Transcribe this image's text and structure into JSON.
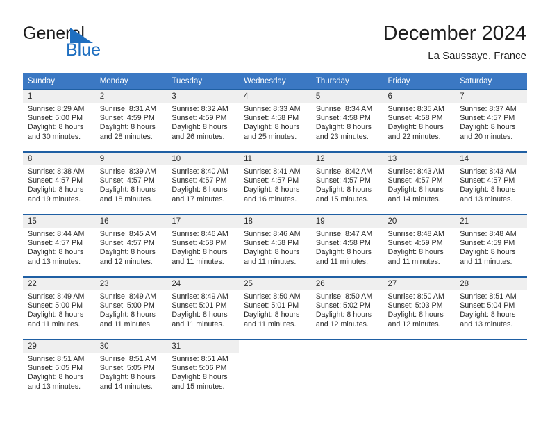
{
  "brand": {
    "name_part1": "General",
    "name_part2": "Blue",
    "triangle_color": "#1f6fc0",
    "icon": "triangle-flag-icon"
  },
  "header": {
    "title": "December 2024",
    "subtitle": "La Saussaye, France"
  },
  "theme": {
    "header_bg": "#3b78c3",
    "row_border": "#1f5fa3",
    "daynum_bg": "#efefef",
    "text": "#2b2b2b",
    "brand_blue": "#1f6fc0"
  },
  "weekdays": [
    "Sunday",
    "Monday",
    "Tuesday",
    "Wednesday",
    "Thursday",
    "Friday",
    "Saturday"
  ],
  "weeks": [
    [
      {
        "day": "1",
        "sunrise": "Sunrise: 8:29 AM",
        "sunset": "Sunset: 5:00 PM",
        "daylight1": "Daylight: 8 hours",
        "daylight2": "and 30 minutes."
      },
      {
        "day": "2",
        "sunrise": "Sunrise: 8:31 AM",
        "sunset": "Sunset: 4:59 PM",
        "daylight1": "Daylight: 8 hours",
        "daylight2": "and 28 minutes."
      },
      {
        "day": "3",
        "sunrise": "Sunrise: 8:32 AM",
        "sunset": "Sunset: 4:59 PM",
        "daylight1": "Daylight: 8 hours",
        "daylight2": "and 26 minutes."
      },
      {
        "day": "4",
        "sunrise": "Sunrise: 8:33 AM",
        "sunset": "Sunset: 4:58 PM",
        "daylight1": "Daylight: 8 hours",
        "daylight2": "and 25 minutes."
      },
      {
        "day": "5",
        "sunrise": "Sunrise: 8:34 AM",
        "sunset": "Sunset: 4:58 PM",
        "daylight1": "Daylight: 8 hours",
        "daylight2": "and 23 minutes."
      },
      {
        "day": "6",
        "sunrise": "Sunrise: 8:35 AM",
        "sunset": "Sunset: 4:58 PM",
        "daylight1": "Daylight: 8 hours",
        "daylight2": "and 22 minutes."
      },
      {
        "day": "7",
        "sunrise": "Sunrise: 8:37 AM",
        "sunset": "Sunset: 4:57 PM",
        "daylight1": "Daylight: 8 hours",
        "daylight2": "and 20 minutes."
      }
    ],
    [
      {
        "day": "8",
        "sunrise": "Sunrise: 8:38 AM",
        "sunset": "Sunset: 4:57 PM",
        "daylight1": "Daylight: 8 hours",
        "daylight2": "and 19 minutes."
      },
      {
        "day": "9",
        "sunrise": "Sunrise: 8:39 AM",
        "sunset": "Sunset: 4:57 PM",
        "daylight1": "Daylight: 8 hours",
        "daylight2": "and 18 minutes."
      },
      {
        "day": "10",
        "sunrise": "Sunrise: 8:40 AM",
        "sunset": "Sunset: 4:57 PM",
        "daylight1": "Daylight: 8 hours",
        "daylight2": "and 17 minutes."
      },
      {
        "day": "11",
        "sunrise": "Sunrise: 8:41 AM",
        "sunset": "Sunset: 4:57 PM",
        "daylight1": "Daylight: 8 hours",
        "daylight2": "and 16 minutes."
      },
      {
        "day": "12",
        "sunrise": "Sunrise: 8:42 AM",
        "sunset": "Sunset: 4:57 PM",
        "daylight1": "Daylight: 8 hours",
        "daylight2": "and 15 minutes."
      },
      {
        "day": "13",
        "sunrise": "Sunrise: 8:43 AM",
        "sunset": "Sunset: 4:57 PM",
        "daylight1": "Daylight: 8 hours",
        "daylight2": "and 14 minutes."
      },
      {
        "day": "14",
        "sunrise": "Sunrise: 8:43 AM",
        "sunset": "Sunset: 4:57 PM",
        "daylight1": "Daylight: 8 hours",
        "daylight2": "and 13 minutes."
      }
    ],
    [
      {
        "day": "15",
        "sunrise": "Sunrise: 8:44 AM",
        "sunset": "Sunset: 4:57 PM",
        "daylight1": "Daylight: 8 hours",
        "daylight2": "and 13 minutes."
      },
      {
        "day": "16",
        "sunrise": "Sunrise: 8:45 AM",
        "sunset": "Sunset: 4:57 PM",
        "daylight1": "Daylight: 8 hours",
        "daylight2": "and 12 minutes."
      },
      {
        "day": "17",
        "sunrise": "Sunrise: 8:46 AM",
        "sunset": "Sunset: 4:58 PM",
        "daylight1": "Daylight: 8 hours",
        "daylight2": "and 11 minutes."
      },
      {
        "day": "18",
        "sunrise": "Sunrise: 8:46 AM",
        "sunset": "Sunset: 4:58 PM",
        "daylight1": "Daylight: 8 hours",
        "daylight2": "and 11 minutes."
      },
      {
        "day": "19",
        "sunrise": "Sunrise: 8:47 AM",
        "sunset": "Sunset: 4:58 PM",
        "daylight1": "Daylight: 8 hours",
        "daylight2": "and 11 minutes."
      },
      {
        "day": "20",
        "sunrise": "Sunrise: 8:48 AM",
        "sunset": "Sunset: 4:59 PM",
        "daylight1": "Daylight: 8 hours",
        "daylight2": "and 11 minutes."
      },
      {
        "day": "21",
        "sunrise": "Sunrise: 8:48 AM",
        "sunset": "Sunset: 4:59 PM",
        "daylight1": "Daylight: 8 hours",
        "daylight2": "and 11 minutes."
      }
    ],
    [
      {
        "day": "22",
        "sunrise": "Sunrise: 8:49 AM",
        "sunset": "Sunset: 5:00 PM",
        "daylight1": "Daylight: 8 hours",
        "daylight2": "and 11 minutes."
      },
      {
        "day": "23",
        "sunrise": "Sunrise: 8:49 AM",
        "sunset": "Sunset: 5:00 PM",
        "daylight1": "Daylight: 8 hours",
        "daylight2": "and 11 minutes."
      },
      {
        "day": "24",
        "sunrise": "Sunrise: 8:49 AM",
        "sunset": "Sunset: 5:01 PM",
        "daylight1": "Daylight: 8 hours",
        "daylight2": "and 11 minutes."
      },
      {
        "day": "25",
        "sunrise": "Sunrise: 8:50 AM",
        "sunset": "Sunset: 5:01 PM",
        "daylight1": "Daylight: 8 hours",
        "daylight2": "and 11 minutes."
      },
      {
        "day": "26",
        "sunrise": "Sunrise: 8:50 AM",
        "sunset": "Sunset: 5:02 PM",
        "daylight1": "Daylight: 8 hours",
        "daylight2": "and 12 minutes."
      },
      {
        "day": "27",
        "sunrise": "Sunrise: 8:50 AM",
        "sunset": "Sunset: 5:03 PM",
        "daylight1": "Daylight: 8 hours",
        "daylight2": "and 12 minutes."
      },
      {
        "day": "28",
        "sunrise": "Sunrise: 8:51 AM",
        "sunset": "Sunset: 5:04 PM",
        "daylight1": "Daylight: 8 hours",
        "daylight2": "and 13 minutes."
      }
    ],
    [
      {
        "day": "29",
        "sunrise": "Sunrise: 8:51 AM",
        "sunset": "Sunset: 5:05 PM",
        "daylight1": "Daylight: 8 hours",
        "daylight2": "and 13 minutes."
      },
      {
        "day": "30",
        "sunrise": "Sunrise: 8:51 AM",
        "sunset": "Sunset: 5:05 PM",
        "daylight1": "Daylight: 8 hours",
        "daylight2": "and 14 minutes."
      },
      {
        "day": "31",
        "sunrise": "Sunrise: 8:51 AM",
        "sunset": "Sunset: 5:06 PM",
        "daylight1": "Daylight: 8 hours",
        "daylight2": "and 15 minutes."
      },
      {
        "day": "",
        "sunrise": "",
        "sunset": "",
        "daylight1": "",
        "daylight2": ""
      },
      {
        "day": "",
        "sunrise": "",
        "sunset": "",
        "daylight1": "",
        "daylight2": ""
      },
      {
        "day": "",
        "sunrise": "",
        "sunset": "",
        "daylight1": "",
        "daylight2": ""
      },
      {
        "day": "",
        "sunrise": "",
        "sunset": "",
        "daylight1": "",
        "daylight2": ""
      }
    ]
  ]
}
